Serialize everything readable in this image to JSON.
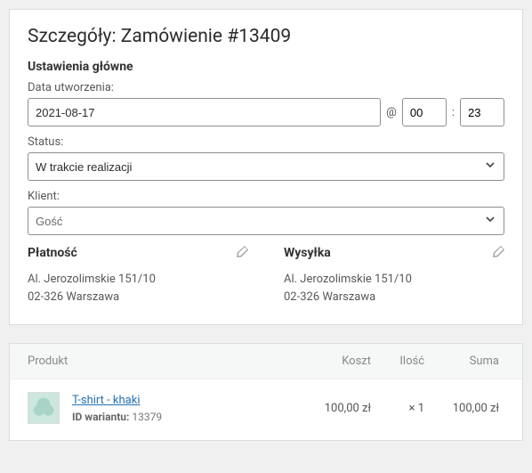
{
  "title": "Szczegóły: Zamówienie #13409",
  "settings_heading": "Ustawienia główne",
  "date_label": "Data utworzenia:",
  "date_value": "2021-08-17",
  "at_symbol": "@",
  "hour_value": "00",
  "time_sep": ":",
  "minute_value": "23",
  "status_label": "Status:",
  "status_value": "W trakcie realizacji",
  "client_label": "Klient:",
  "client_value": "Gość",
  "billing": {
    "heading": "Płatność",
    "line1": "Al. Jerozolimskie 151/10",
    "line2": "02-326 Warszawa"
  },
  "shipping": {
    "heading": "Wysyłka",
    "line1": "Al. Jerozolimskie 151/10",
    "line2": "02-326 Warszawa"
  },
  "cols": {
    "product": "Produkt",
    "cost": "Koszt",
    "qty": "Ilość",
    "sum": "Suma"
  },
  "item": {
    "name": "T-shirt - khaki",
    "variant_lbl": "ID wariantu:",
    "variant_val": "13379",
    "cost": "100,00 zł",
    "qty": "× 1",
    "sum": "100,00 zł"
  }
}
